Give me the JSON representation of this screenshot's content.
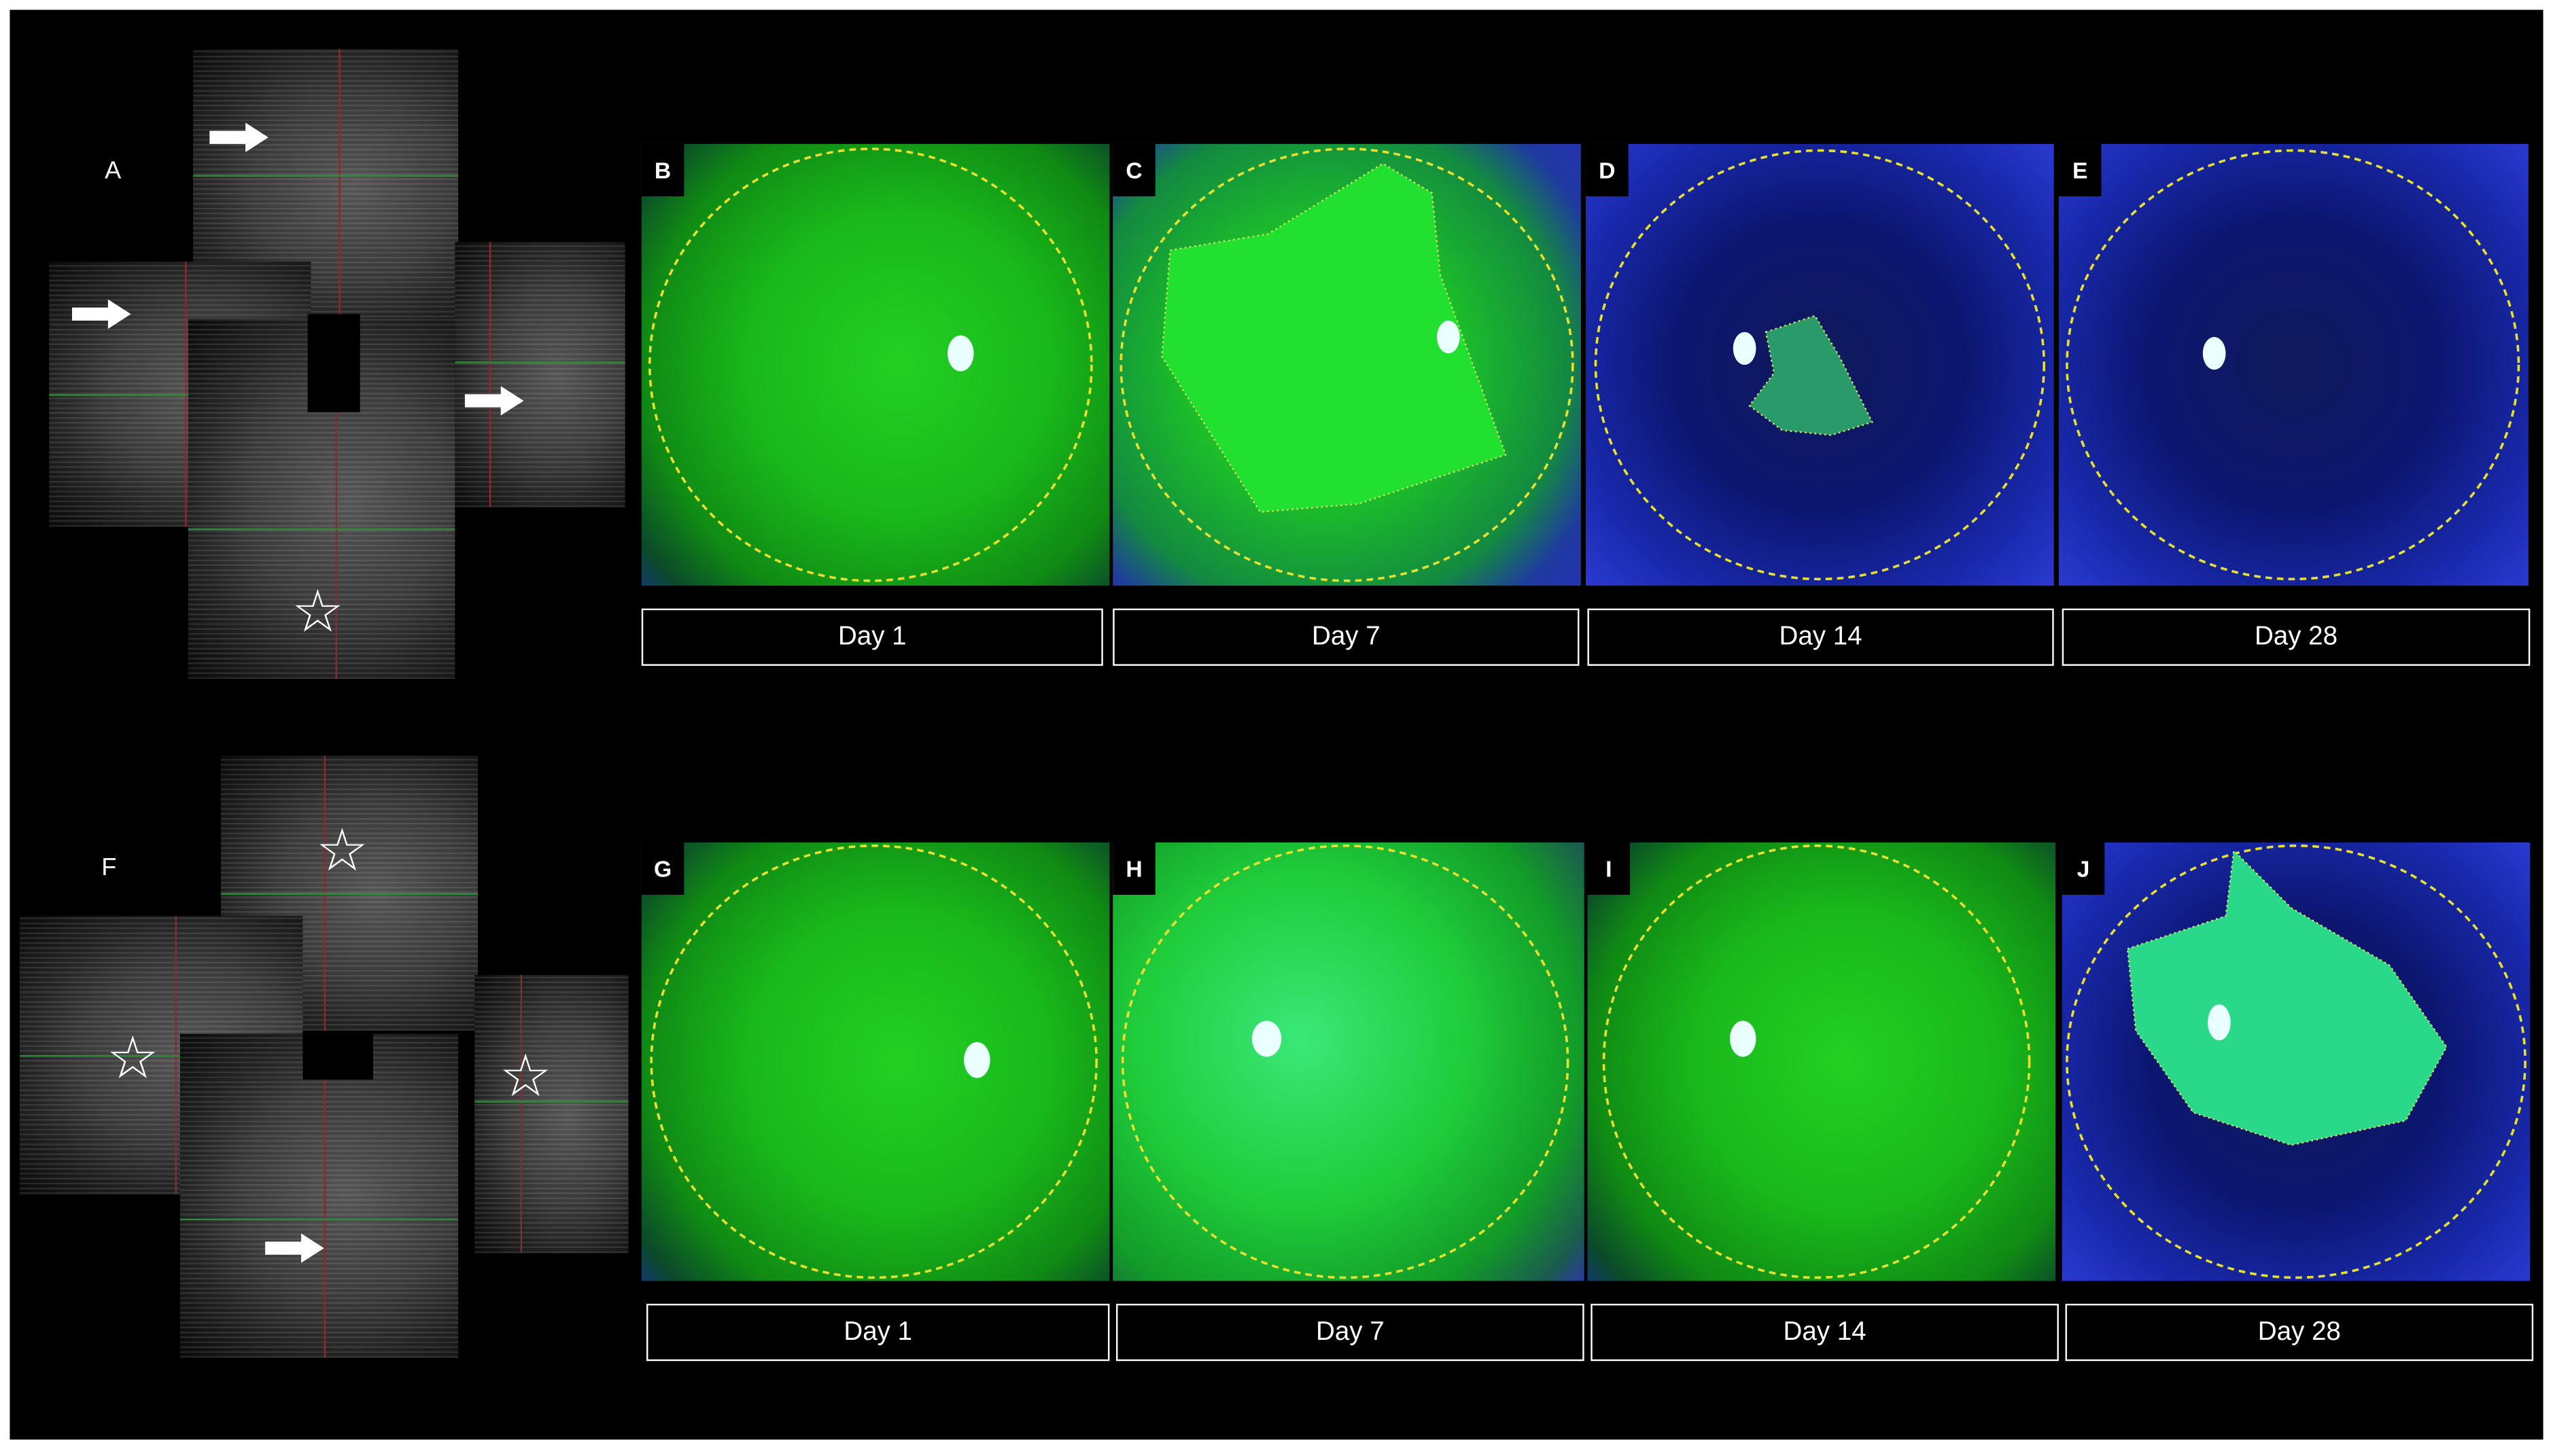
{
  "figure": {
    "top_row": {
      "mosaic_label": "A",
      "panels": [
        {
          "label": "B",
          "day": "Day 1",
          "style": "green"
        },
        {
          "label": "C",
          "day": "Day 7",
          "style": "mixed"
        },
        {
          "label": "D",
          "day": "Day 14",
          "style": "blue"
        },
        {
          "label": "E",
          "day": "Day 28",
          "style": "blue"
        }
      ]
    },
    "bottom_row": {
      "mosaic_label": "F",
      "panels": [
        {
          "label": "G",
          "day": "Day 1",
          "style": "green"
        },
        {
          "label": "H",
          "day": "Day 7",
          "style": "cyan"
        },
        {
          "label": "I",
          "day": "Day 14",
          "style": "green"
        },
        {
          "label": "J",
          "day": "Day 28",
          "style": "blue"
        }
      ]
    },
    "colors": {
      "circle": "#e8e030",
      "lesion_outline": "#e8e860",
      "background": "#000000"
    }
  }
}
